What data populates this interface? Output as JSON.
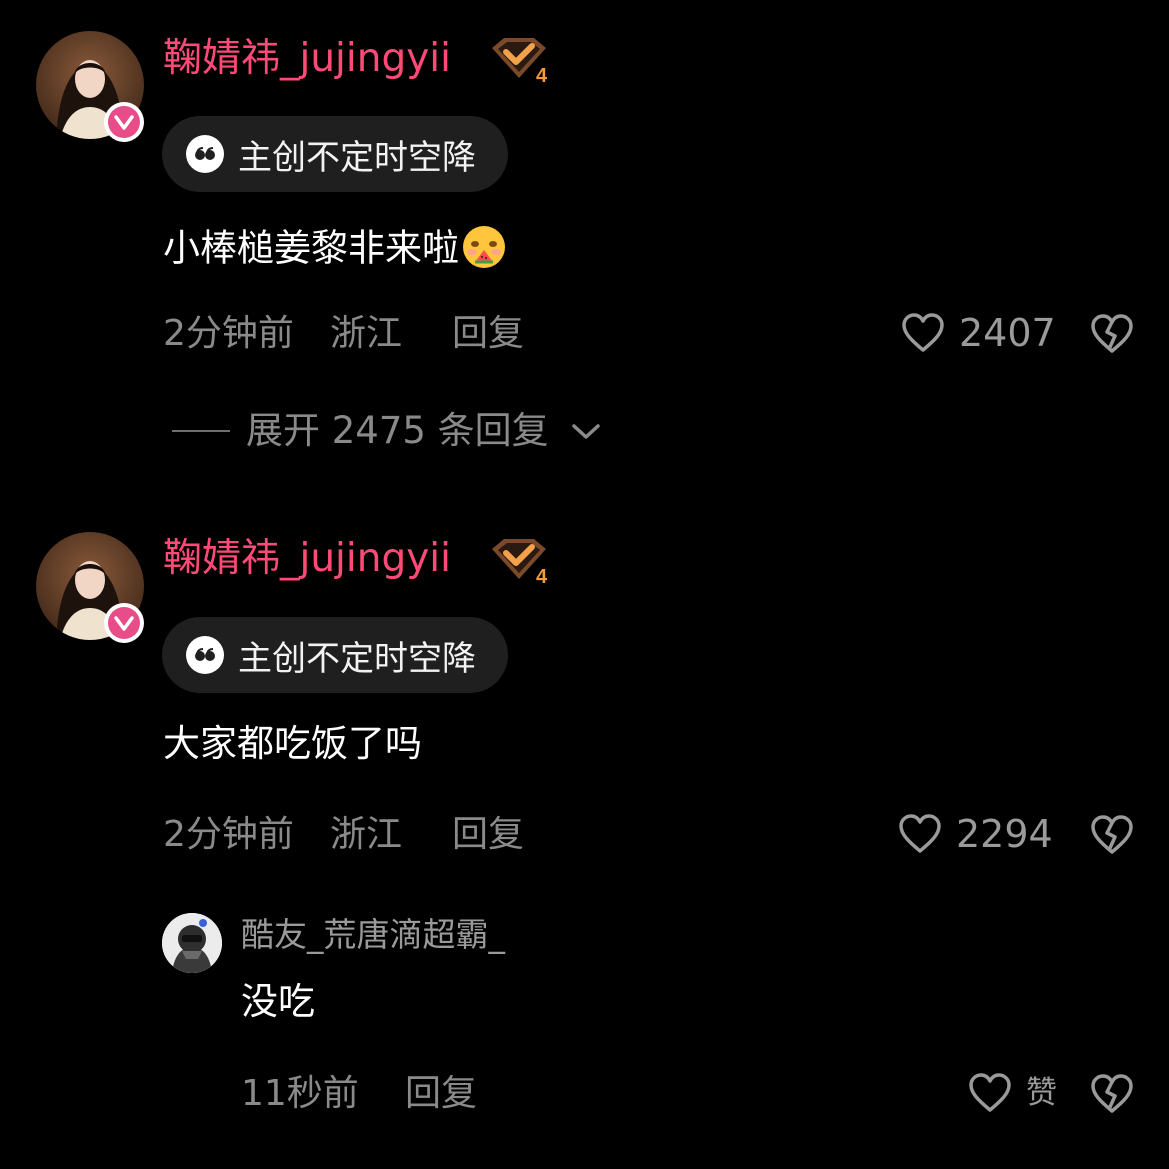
{
  "comments": [
    {
      "username": "鞠婧祎_jujingyii",
      "badge_level": "4",
      "tag": "主创不定时空降",
      "text": "小棒槌姜黎非来啦",
      "time": "2分钟前",
      "location": "浙江",
      "reply_label": "回复",
      "likes": "2407",
      "expand_label": "展开 2475 条回复"
    },
    {
      "username": "鞠婧祎_jujingyii",
      "badge_level": "4",
      "tag": "主创不定时空降",
      "text": "大家都吃饭了吗",
      "time": "2分钟前",
      "location": "浙江",
      "reply_label": "回复",
      "likes": "2294"
    }
  ],
  "reply": {
    "username": "酷友_荒唐滴超霸_",
    "text": "没吃",
    "time": "11秒前",
    "reply_label": "回复",
    "like_label": "赞"
  },
  "colors": {
    "username": "#ff4a78",
    "muted": "#8a8a8a",
    "pill_bg": "#1f1f1f",
    "verified": "#e84d8a"
  }
}
